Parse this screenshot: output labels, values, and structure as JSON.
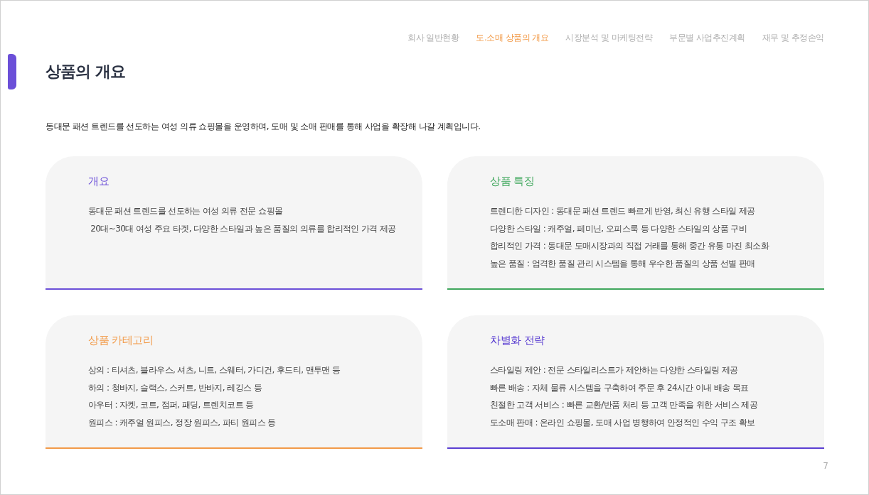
{
  "nav": [
    {
      "label": "회사 일반현황",
      "selected": false
    },
    {
      "label": "도.소매 상품의 개요",
      "selected": true
    },
    {
      "label": "시장분석 및 마케팅전략",
      "selected": false
    },
    {
      "label": "부문별 사업추진계획",
      "selected": false
    },
    {
      "label": "재무 및 추정손익",
      "selected": false
    }
  ],
  "title": "상품의 개요",
  "description": "동대문 패션 트렌드를 선도하는 여성 의류 쇼핑몰을 운영하며, 도매 및 소매 판매를 통해 사업을 확장해 나갈 계획입니다.",
  "cards": [
    {
      "title": "개요",
      "color": "#6b4fd8",
      "lines": [
        "동대문 패션 트렌드를 선도하는 여성 의류 전문 쇼핑몰",
        " 20대~30대 여성 주요 타겟, 다양한 스타일과 높은 품질의 의류를 합리적인 가격 제공"
      ]
    },
    {
      "title": "상품 특징",
      "color": "#3fa75c",
      "lines": [
        "트렌디한 디자인 : 동대문 패션 트렌드 빠르게 반영, 최신 유행 스타일 제공",
        "다양한 스타일 : 캐주얼, 페미닌, 오피스룩 등 다양한 스타일의 상품 구비",
        "합리적인 가격 : 동대문 도매시장과의 직접 거래를 통해 중간 유통 마진 최소화",
        "높은 품질 : 엄격한 품질 관리 시스템을 통해 우수한 품질의 상품 선별 판매"
      ]
    },
    {
      "title": "상품 카테고리",
      "color": "#f29a48",
      "lines": [
        "상의 : 티셔츠, 블라우스, 셔츠, 니트, 스웨터, 가디건, 후드티, 맨투맨 등",
        "하의 : 청바지, 슬랙스, 스커트, 반바지, 레깅스 등",
        "아우터 : 자켓, 코트, 점퍼, 패딩, 트렌치코트 등",
        "원피스 : 캐주얼 원피스, 정장 원피스, 파티 원피스 등"
      ]
    },
    {
      "title": "차별화 전략",
      "color": "#5b3fd2",
      "lines": [
        "스타일링 제안 : 전문 스타일리스트가 제안하는 다양한 스타일링 제공",
        "빠른 배송 : 자체 물류 시스템을 구축하여 주문 후 24시간 이내 배송 목표",
        "친절한 고객 서비스 : 빠른 교환/반품 처리 등 고객 만족을 위한 서비스 제공",
        "도소매 판매 : 온라인 쇼핑몰, 도매 사업 병행하여 안정적인 수익 구조 확보"
      ]
    }
  ],
  "page_number": "7"
}
